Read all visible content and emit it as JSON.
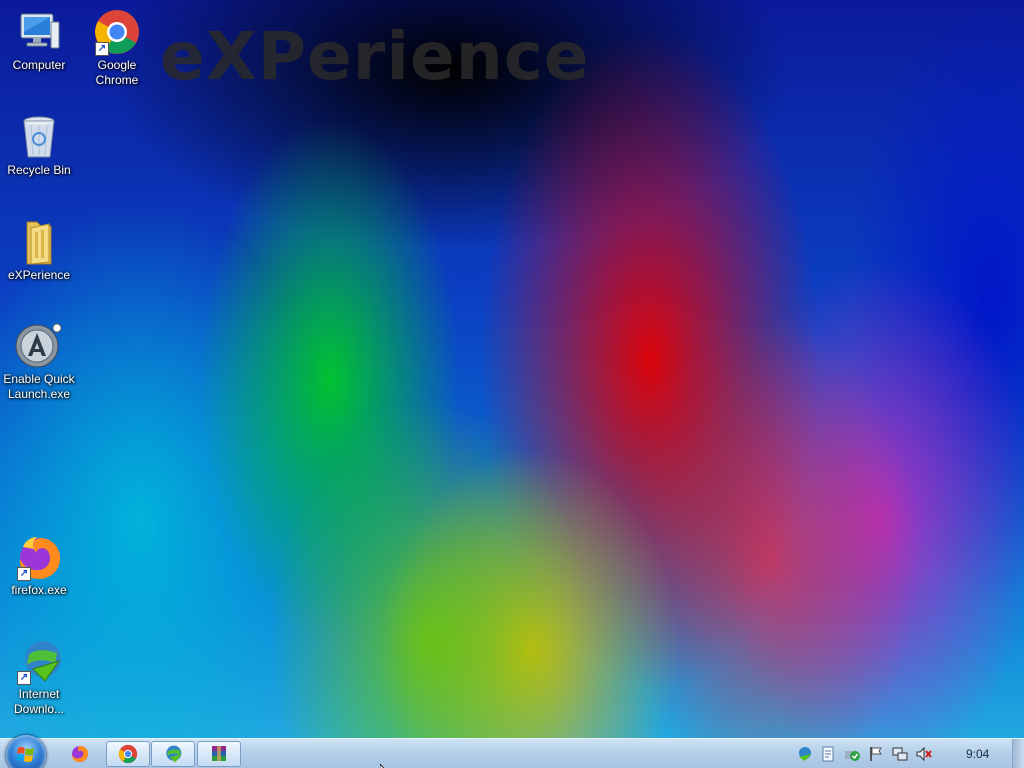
{
  "wallpaper": {
    "logo_text": "eXPerience"
  },
  "desktop_icons": [
    {
      "label": "Computer"
    },
    {
      "label": "Google Chrome"
    },
    {
      "label": "Recycle Bin"
    },
    {
      "label": "eXPerience"
    },
    {
      "label": "Enable Quick Launch.exe"
    },
    {
      "label": "firefox.exe"
    },
    {
      "label": "Internet Downlo..."
    }
  ],
  "taskbar": {
    "start_icon": "windows-start-orb",
    "buttons": [
      {
        "icon": "firefox-icon"
      },
      {
        "icon": "chrome-icon"
      },
      {
        "icon": "internet-download-manager-icon"
      },
      {
        "icon": "winrar-icon"
      }
    ],
    "tray_icons": [
      "idm-tray-icon",
      "document-icon",
      "security-icon",
      "flag-icon",
      "network-icon",
      "volume-muted-icon"
    ],
    "clock": "9:04"
  },
  "colors": {
    "taskbar_top": "#cfe3f3",
    "taskbar_bottom": "#a7c4e3",
    "desktop_text": "#ffffff"
  }
}
